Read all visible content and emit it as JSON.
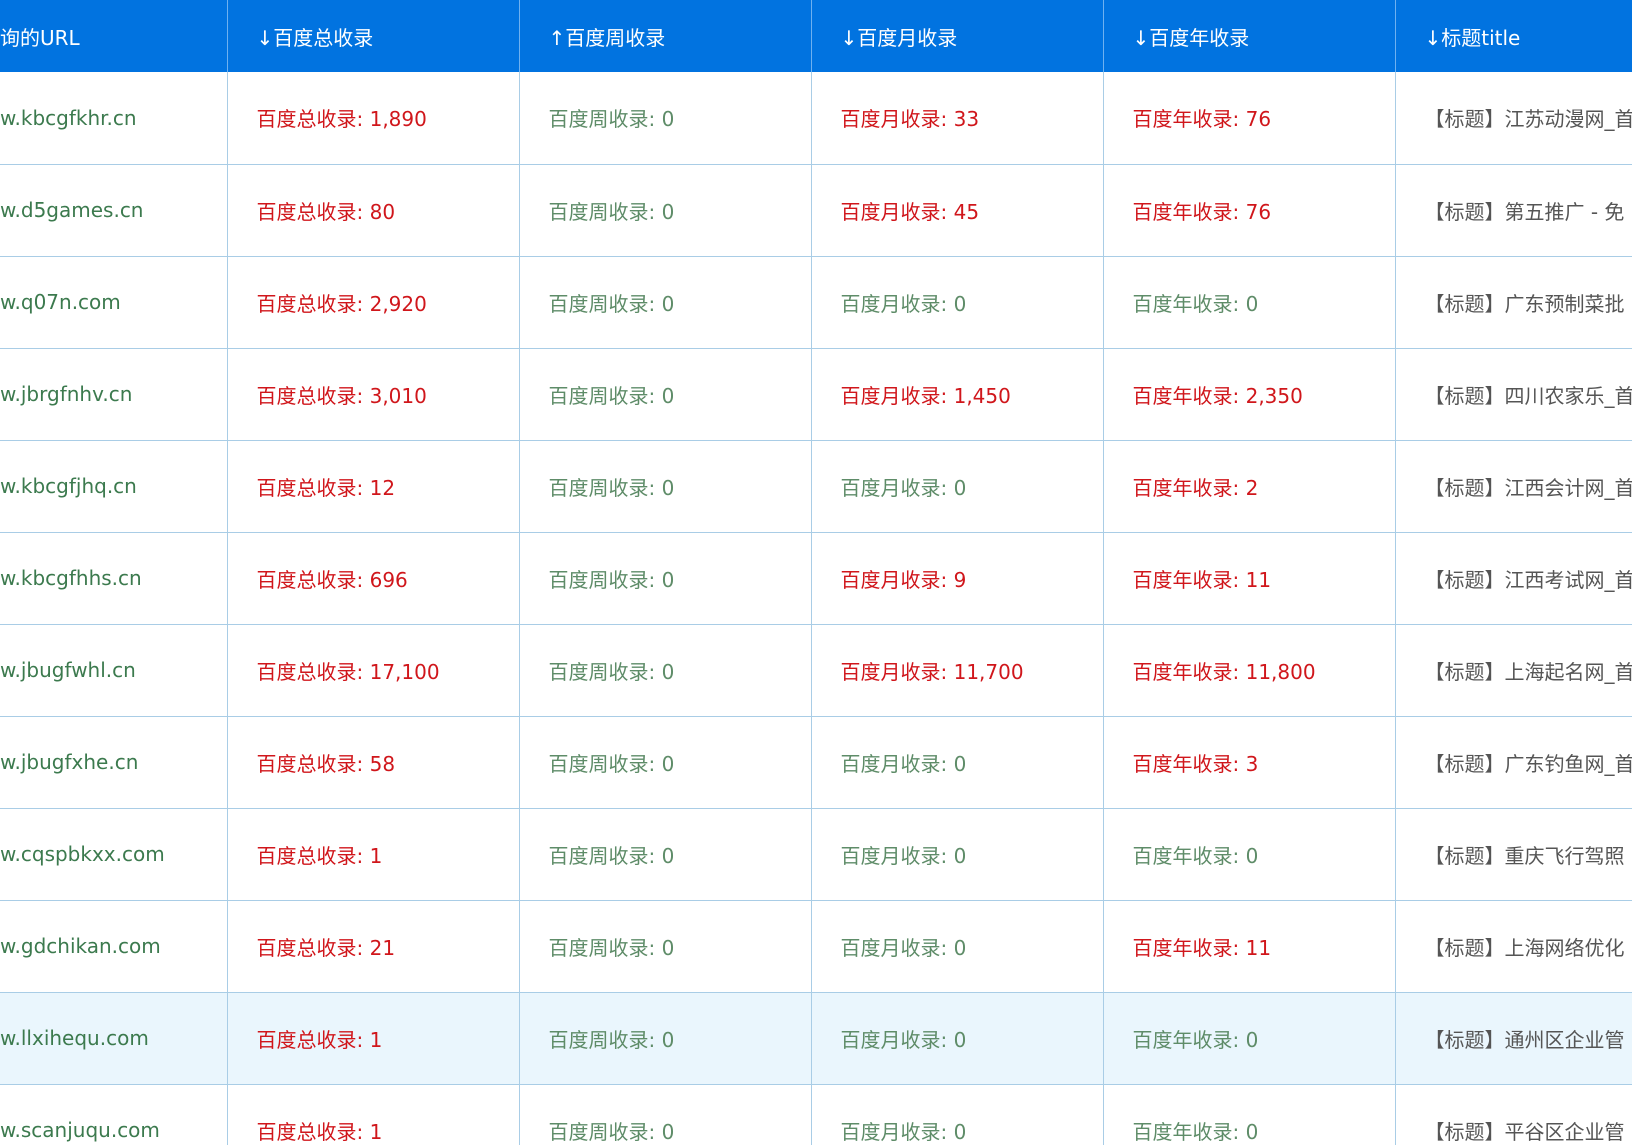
{
  "table": {
    "headers": {
      "url": "询的URL",
      "total": "↓百度总收录",
      "week": "↑百度周收录",
      "month": "↓百度月收录",
      "year": "↓百度年收录",
      "title": "↓标题title"
    },
    "rows": [
      {
        "url": "w.kbcgfkhr.cn",
        "total": "百度总收录: 1,890",
        "week": "百度周收录: 0",
        "month": "百度月收录: 33",
        "year": "百度年收录: 76",
        "title": "【标题】江苏动漫网_首"
      },
      {
        "url": "w.d5games.cn",
        "total": "百度总收录: 80",
        "week": "百度周收录: 0",
        "month": "百度月收录: 45",
        "year": "百度年收录: 76",
        "title": "【标题】第五推广 - 免"
      },
      {
        "url": "w.q07n.com",
        "total": "百度总收录: 2,920",
        "week": "百度周收录: 0",
        "month": "百度月收录: 0",
        "year": "百度年收录: 0",
        "title": "【标题】广东预制菜批"
      },
      {
        "url": "w.jbrgfnhv.cn",
        "total": "百度总收录: 3,010",
        "week": "百度周收录: 0",
        "month": "百度月收录: 1,450",
        "year": "百度年收录: 2,350",
        "title": "【标题】四川农家乐_首"
      },
      {
        "url": "w.kbcgfjhq.cn",
        "total": "百度总收录: 12",
        "week": "百度周收录: 0",
        "month": "百度月收录: 0",
        "year": "百度年收录: 2",
        "title": "【标题】江西会计网_首"
      },
      {
        "url": "w.kbcgfhhs.cn",
        "total": "百度总收录: 696",
        "week": "百度周收录: 0",
        "month": "百度月收录: 9",
        "year": "百度年收录: 11",
        "title": "【标题】江西考试网_首"
      },
      {
        "url": "w.jbugfwhl.cn",
        "total": "百度总收录: 17,100",
        "week": "百度周收录: 0",
        "month": "百度月收录: 11,700",
        "year": "百度年收录: 11,800",
        "title": "【标题】上海起名网_首"
      },
      {
        "url": "w.jbugfxhe.cn",
        "total": "百度总收录: 58",
        "week": "百度周收录: 0",
        "month": "百度月收录: 0",
        "year": "百度年收录: 3",
        "title": "【标题】广东钓鱼网_首"
      },
      {
        "url": "w.cqspbkxx.com",
        "total": "百度总收录: 1",
        "week": "百度周收录: 0",
        "month": "百度月收录: 0",
        "year": "百度年收录: 0",
        "title": "【标题】重庆飞行驾照"
      },
      {
        "url": "w.gdchikan.com",
        "total": "百度总收录: 21",
        "week": "百度周收录: 0",
        "month": "百度月收录: 0",
        "year": "百度年收录: 11",
        "title": "【标题】上海网络优化"
      },
      {
        "url": "w.llxihequ.com",
        "total": "百度总收录: 1",
        "week": "百度周收录: 0",
        "month": "百度月收录: 0",
        "year": "百度年收录: 0",
        "title": "【标题】通州区企业管"
      },
      {
        "url": "w.scanjuqu.com",
        "total": "百度总收录: 1",
        "week": "百度周收录: 0",
        "month": "百度月收录: 0",
        "year": "百度年收录: 0",
        "title": "【标题】平谷区企业管"
      }
    ]
  }
}
